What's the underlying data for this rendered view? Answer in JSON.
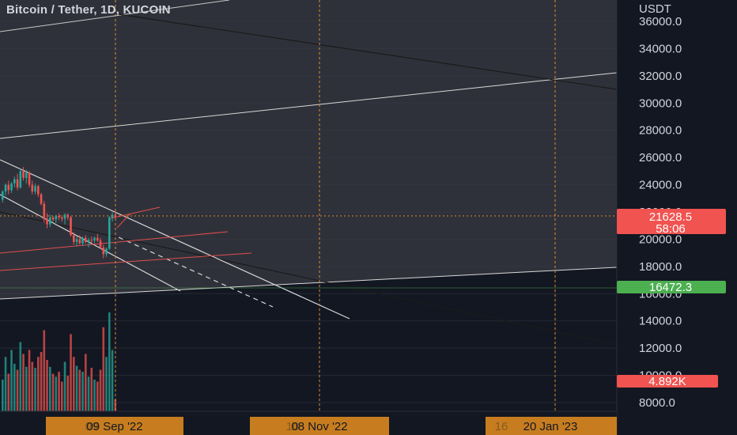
{
  "header": {
    "symbol_title": "Bitcoin / Tether, 1D, KUCOIN"
  },
  "chart_data": {
    "type": "candlestick",
    "currency_label": "USDT",
    "y_ticks": [
      "36000.0",
      "34000.0",
      "32000.0",
      "30000.0",
      "28000.0",
      "26000.0",
      "24000.0",
      "22000.0",
      "20000.0",
      "18000.0",
      "16000.0",
      "14000.0",
      "12000.0",
      "10000.0",
      "8000.0"
    ],
    "ylim": [
      7000,
      37500
    ],
    "price_badge": {
      "value": "21628.5",
      "countdown": "58:06",
      "color": "#f05350"
    },
    "level_badge": {
      "value": "16472.3",
      "color": "#4caf50"
    },
    "volume_badge": {
      "value": "4.892K",
      "color": "#f05350"
    },
    "date_labels": [
      "09 Sep '22",
      "08 Nov '22",
      "20 Jan '23"
    ],
    "date_overlays": [
      "09",
      "10",
      "16"
    ],
    "candles": [
      {
        "o": 22900,
        "h": 23600,
        "l": 22700,
        "c": 23500
      },
      {
        "o": 23500,
        "h": 24100,
        "l": 23200,
        "c": 24000
      },
      {
        "o": 24000,
        "h": 24300,
        "l": 23300,
        "c": 23600
      },
      {
        "o": 23600,
        "h": 24200,
        "l": 23400,
        "c": 24100
      },
      {
        "o": 24100,
        "h": 24600,
        "l": 23800,
        "c": 24400
      },
      {
        "o": 24400,
        "h": 24800,
        "l": 23600,
        "c": 23800
      },
      {
        "o": 23800,
        "h": 25200,
        "l": 23700,
        "c": 25000
      },
      {
        "o": 25000,
        "h": 25300,
        "l": 24300,
        "c": 24500
      },
      {
        "o": 24500,
        "h": 25100,
        "l": 24100,
        "c": 24900
      },
      {
        "o": 24900,
        "h": 25000,
        "l": 23800,
        "c": 24000
      },
      {
        "o": 24000,
        "h": 24300,
        "l": 23300,
        "c": 23500
      },
      {
        "o": 23500,
        "h": 24100,
        "l": 23300,
        "c": 23900
      },
      {
        "o": 23900,
        "h": 24000,
        "l": 23100,
        "c": 23300
      },
      {
        "o": 23300,
        "h": 23400,
        "l": 22500,
        "c": 22600
      },
      {
        "o": 22600,
        "h": 22800,
        "l": 21200,
        "c": 21500
      },
      {
        "o": 21500,
        "h": 21900,
        "l": 20800,
        "c": 21100
      },
      {
        "o": 21100,
        "h": 21800,
        "l": 20900,
        "c": 21600
      },
      {
        "o": 21600,
        "h": 21700,
        "l": 21300,
        "c": 21450
      },
      {
        "o": 21450,
        "h": 21800,
        "l": 21200,
        "c": 21700
      },
      {
        "o": 21700,
        "h": 21900,
        "l": 21400,
        "c": 21600
      },
      {
        "o": 21600,
        "h": 21750,
        "l": 21300,
        "c": 21500
      },
      {
        "o": 21500,
        "h": 21900,
        "l": 21100,
        "c": 21800
      },
      {
        "o": 21800,
        "h": 21900,
        "l": 21400,
        "c": 21600
      },
      {
        "o": 21600,
        "h": 21700,
        "l": 20200,
        "c": 20300
      },
      {
        "o": 20300,
        "h": 20500,
        "l": 19600,
        "c": 19800
      },
      {
        "o": 19800,
        "h": 20200,
        "l": 19500,
        "c": 20000
      },
      {
        "o": 20000,
        "h": 20300,
        "l": 19600,
        "c": 19700
      },
      {
        "o": 19700,
        "h": 20200,
        "l": 19500,
        "c": 20100
      },
      {
        "o": 20100,
        "h": 20300,
        "l": 19700,
        "c": 19800
      },
      {
        "o": 19800,
        "h": 20100,
        "l": 19400,
        "c": 19950
      },
      {
        "o": 19950,
        "h": 20200,
        "l": 19700,
        "c": 19900
      },
      {
        "o": 19900,
        "h": 20200,
        "l": 19700,
        "c": 20100
      },
      {
        "o": 20100,
        "h": 20400,
        "l": 19800,
        "c": 19900
      },
      {
        "o": 19900,
        "h": 20100,
        "l": 19300,
        "c": 19400
      },
      {
        "o": 19400,
        "h": 19600,
        "l": 18600,
        "c": 18900
      },
      {
        "o": 18900,
        "h": 19400,
        "l": 18700,
        "c": 19300
      },
      {
        "o": 19300,
        "h": 21700,
        "l": 19200,
        "c": 21600
      },
      {
        "o": 21600,
        "h": 22000,
        "l": 21300,
        "c": 21800
      },
      {
        "o": 21800,
        "h": 22200,
        "l": 21500,
        "c": 21629
      }
    ],
    "volumes": [
      0.32,
      0.55,
      0.38,
      0.62,
      0.48,
      0.42,
      0.7,
      0.58,
      0.45,
      0.62,
      0.5,
      0.44,
      0.55,
      0.6,
      0.82,
      0.52,
      0.45,
      0.38,
      0.35,
      0.4,
      0.3,
      0.5,
      0.36,
      0.78,
      0.55,
      0.46,
      0.42,
      0.4,
      0.58,
      0.35,
      0.44,
      0.32,
      0.3,
      0.42,
      0.85,
      0.55,
      1.0,
      0.62,
      0.12
    ]
  }
}
